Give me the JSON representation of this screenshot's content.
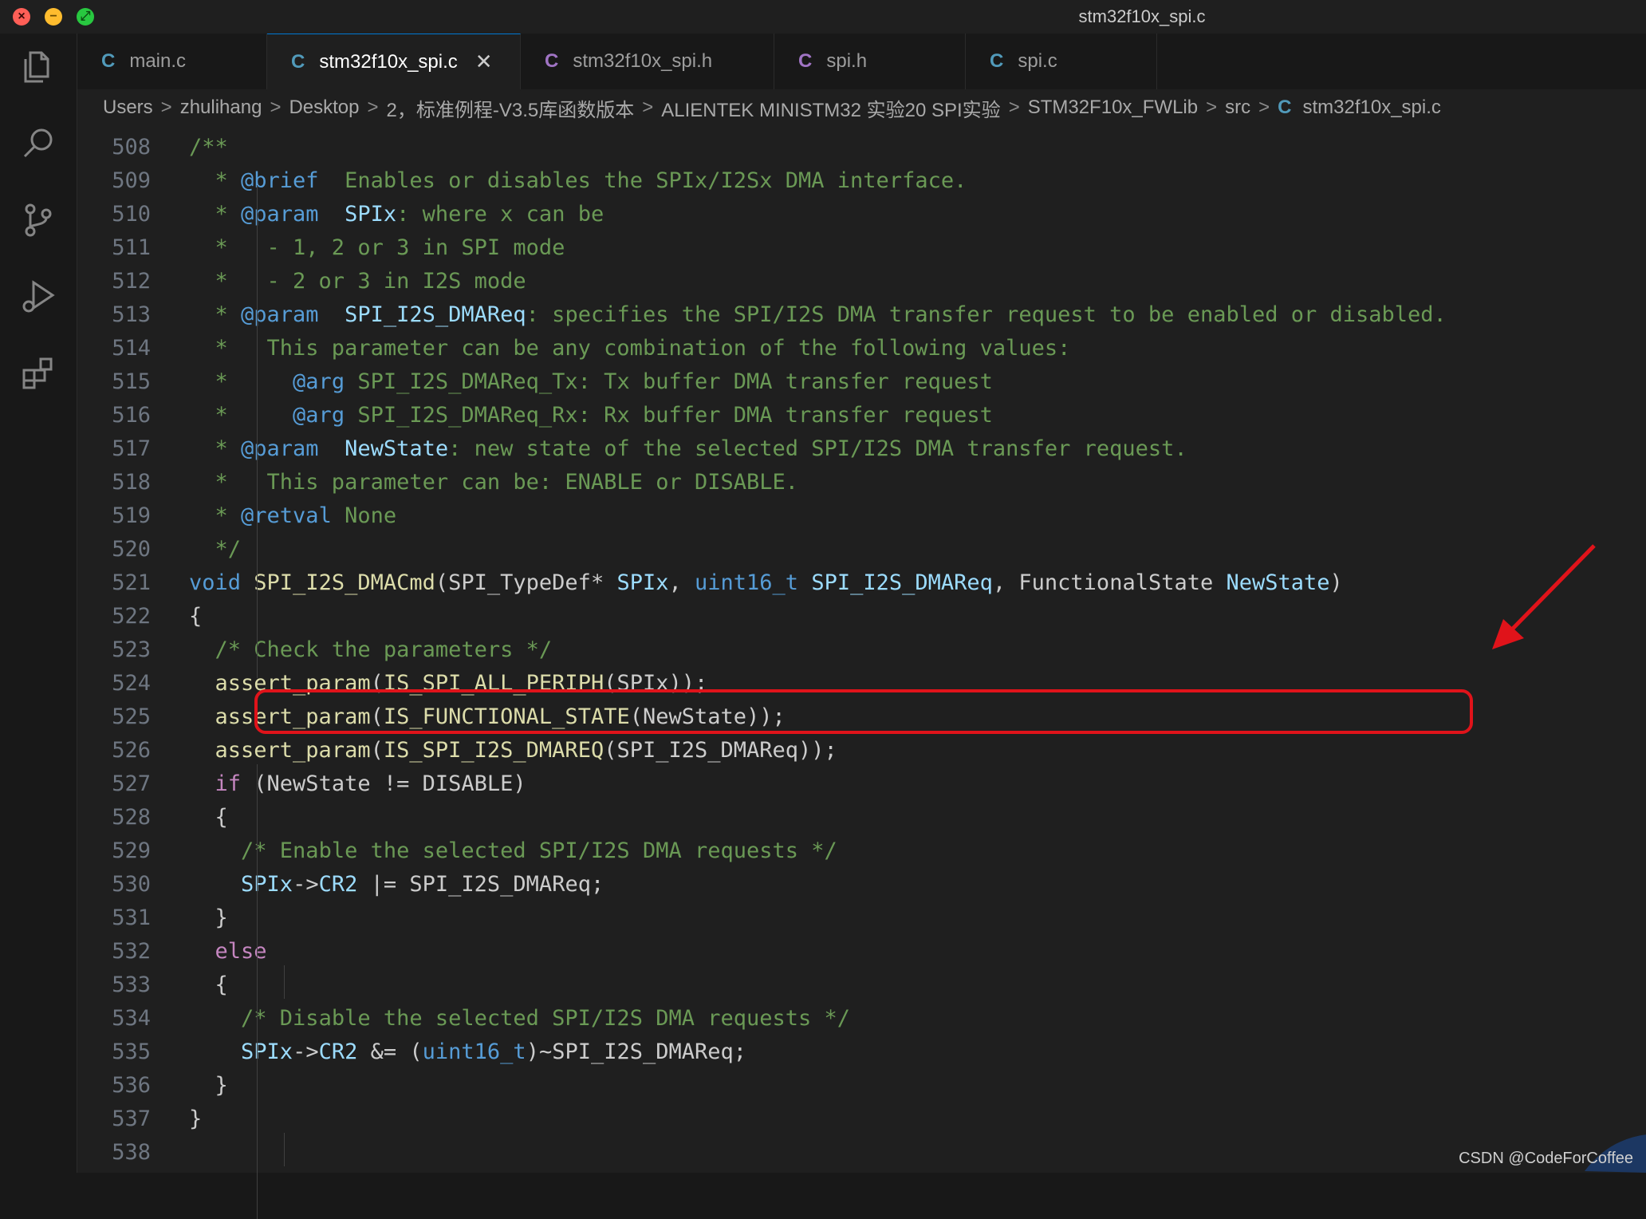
{
  "window": {
    "title": "stm32f10x_spi.c"
  },
  "tabs": [
    {
      "icon": "C",
      "kind": "c",
      "label": "main.c",
      "active": false
    },
    {
      "icon": "C",
      "kind": "c",
      "label": "stm32f10x_spi.c",
      "active": true,
      "close": "✕"
    },
    {
      "icon": "C",
      "kind": "h",
      "label": "stm32f10x_spi.h",
      "active": false
    },
    {
      "icon": "C",
      "kind": "h",
      "label": "spi.h",
      "active": false
    },
    {
      "icon": "C",
      "kind": "c",
      "label": "spi.c",
      "active": false
    }
  ],
  "breadcrumb": {
    "items": [
      "Users",
      "zhulihang",
      "Desktop",
      "2，标准例程-V3.5库函数版本",
      "ALIENTEK MINISTM32 实验20 SPI实验",
      "STM32F10x_FWLib",
      "src"
    ],
    "file_icon": "C",
    "file": "stm32f10x_spi.c",
    "sep": ">"
  },
  "activity_icons": [
    "explorer-icon",
    "search-icon",
    "source-control-icon",
    "run-debug-icon",
    "extensions-icon"
  ],
  "code_lines": [
    {
      "n": "508",
      "t": [
        [
          "cm",
          "/**"
        ]
      ]
    },
    {
      "n": "509",
      "t": [
        [
          "cm",
          "  * "
        ],
        [
          "tag",
          "@brief"
        ],
        [
          "cm",
          "  Enables or disables the SPIx/I2Sx DMA interface."
        ]
      ]
    },
    {
      "n": "510",
      "t": [
        [
          "cm",
          "  * "
        ],
        [
          "tag",
          "@param"
        ],
        [
          "cm",
          "  "
        ],
        [
          "ident",
          "SPIx"
        ],
        [
          "cm",
          ": where x can be"
        ]
      ]
    },
    {
      "n": "511",
      "t": [
        [
          "cm",
          "  *   - 1, 2 or 3 in SPI mode"
        ]
      ]
    },
    {
      "n": "512",
      "t": [
        [
          "cm",
          "  *   - 2 or 3 in I2S mode"
        ]
      ]
    },
    {
      "n": "513",
      "t": [
        [
          "cm",
          "  * "
        ],
        [
          "tag",
          "@param"
        ],
        [
          "cm",
          "  "
        ],
        [
          "ident",
          "SPI_I2S_DMAReq"
        ],
        [
          "cm",
          ": specifies the SPI/I2S DMA transfer request to be enabled or disabled."
        ]
      ]
    },
    {
      "n": "514",
      "t": [
        [
          "cm",
          "  *   This parameter can be any combination of the following values:"
        ]
      ]
    },
    {
      "n": "515",
      "t": [
        [
          "cm",
          "  *     "
        ],
        [
          "tag",
          "@arg"
        ],
        [
          "cm",
          " SPI_I2S_DMAReq_Tx: Tx buffer DMA transfer request"
        ]
      ]
    },
    {
      "n": "516",
      "t": [
        [
          "cm",
          "  *     "
        ],
        [
          "tag",
          "@arg"
        ],
        [
          "cm",
          " SPI_I2S_DMAReq_Rx: Rx buffer DMA transfer request"
        ]
      ]
    },
    {
      "n": "517",
      "t": [
        [
          "cm",
          "  * "
        ],
        [
          "tag",
          "@param"
        ],
        [
          "cm",
          "  "
        ],
        [
          "ident",
          "NewState"
        ],
        [
          "cm",
          ": new state of the selected SPI/I2S DMA transfer request."
        ]
      ]
    },
    {
      "n": "518",
      "t": [
        [
          "cm",
          "  *   This parameter can be: ENABLE or DISABLE."
        ]
      ]
    },
    {
      "n": "519",
      "t": [
        [
          "cm",
          "  * "
        ],
        [
          "tag",
          "@retval"
        ],
        [
          "cm",
          " None"
        ]
      ]
    },
    {
      "n": "520",
      "t": [
        [
          "cm",
          "  */"
        ]
      ]
    },
    {
      "n": "521",
      "t": [
        [
          "kw",
          "void"
        ],
        [
          "p",
          " "
        ],
        [
          "fn",
          "SPI_I2S_DMACmd"
        ],
        [
          "p",
          "(SPI_TypeDef* "
        ],
        [
          "ident",
          "SPIx"
        ],
        [
          "p",
          ", "
        ],
        [
          "kw",
          "uint16_t"
        ],
        [
          "p",
          " "
        ],
        [
          "ident",
          "SPI_I2S_DMAReq"
        ],
        [
          "p",
          ", FunctionalState "
        ],
        [
          "ident",
          "NewState"
        ],
        [
          "p",
          ")"
        ]
      ]
    },
    {
      "n": "522",
      "t": [
        [
          "p",
          "{"
        ]
      ]
    },
    {
      "n": "523",
      "t": [
        [
          "p",
          "  "
        ],
        [
          "cm",
          "/* Check the parameters */"
        ]
      ]
    },
    {
      "n": "524",
      "t": [
        [
          "p",
          "  "
        ],
        [
          "fn",
          "assert_param"
        ],
        [
          "p",
          "("
        ],
        [
          "fn",
          "IS_SPI_ALL_PERIPH"
        ],
        [
          "p",
          "(SPIx));"
        ]
      ]
    },
    {
      "n": "525",
      "t": [
        [
          "p",
          "  "
        ],
        [
          "fn",
          "assert_param"
        ],
        [
          "p",
          "("
        ],
        [
          "fn",
          "IS_FUNCTIONAL_STATE"
        ],
        [
          "p",
          "(NewState));"
        ]
      ]
    },
    {
      "n": "526",
      "t": [
        [
          "p",
          "  "
        ],
        [
          "fn",
          "assert_param"
        ],
        [
          "p",
          "("
        ],
        [
          "fn",
          "IS_SPI_I2S_DMAREQ"
        ],
        [
          "p",
          "(SPI_I2S_DMAReq));"
        ]
      ]
    },
    {
      "n": "527",
      "t": [
        [
          "p",
          "  "
        ],
        [
          "ctl",
          "if"
        ],
        [
          "p",
          " (NewState != DISABLE)"
        ]
      ]
    },
    {
      "n": "528",
      "t": [
        [
          "p",
          "  {"
        ]
      ]
    },
    {
      "n": "529",
      "t": [
        [
          "p",
          "    "
        ],
        [
          "cm",
          "/* Enable the selected SPI/I2S DMA requests */"
        ]
      ]
    },
    {
      "n": "530",
      "t": [
        [
          "p",
          "    "
        ],
        [
          "ident",
          "SPIx"
        ],
        [
          "p",
          "->"
        ],
        [
          "ident",
          "CR2"
        ],
        [
          "p",
          " |= SPI_I2S_DMAReq;"
        ]
      ]
    },
    {
      "n": "531",
      "t": [
        [
          "p",
          "  }"
        ]
      ]
    },
    {
      "n": "532",
      "t": [
        [
          "p",
          "  "
        ],
        [
          "ctl",
          "else"
        ]
      ]
    },
    {
      "n": "533",
      "t": [
        [
          "p",
          "  {"
        ]
      ]
    },
    {
      "n": "534",
      "t": [
        [
          "p",
          "    "
        ],
        [
          "cm",
          "/* Disable the selected SPI/I2S DMA requests */"
        ]
      ]
    },
    {
      "n": "535",
      "t": [
        [
          "p",
          "    "
        ],
        [
          "ident",
          "SPIx"
        ],
        [
          "p",
          "->"
        ],
        [
          "ident",
          "CR2"
        ],
        [
          "p",
          " &= ("
        ],
        [
          "kw",
          "uint16_t"
        ],
        [
          "p",
          ")~SPI_I2S_DMAReq;"
        ]
      ]
    },
    {
      "n": "536",
      "t": [
        [
          "p",
          "  }"
        ]
      ]
    },
    {
      "n": "537",
      "t": [
        [
          "p",
          "}"
        ]
      ]
    },
    {
      "n": "538",
      "t": []
    }
  ],
  "watermark": "CSDN @CodeForCoffee",
  "colors": {
    "accent": "#0078d4",
    "highlight": "#e0131a",
    "comment": "#6a9955",
    "keyword": "#569cd6",
    "function": "#dcdcaa"
  }
}
